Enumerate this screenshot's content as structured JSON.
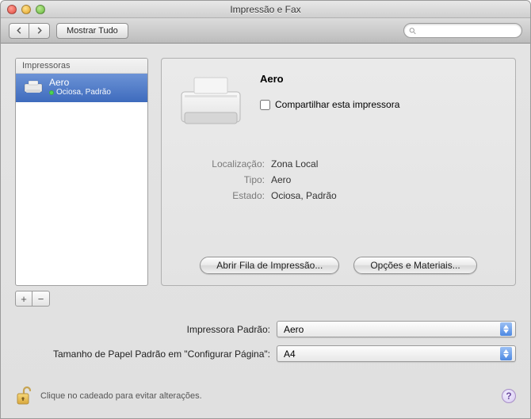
{
  "window": {
    "title": "Impressão e Fax"
  },
  "toolbar": {
    "show_all": "Mostrar Tudo",
    "search_placeholder": ""
  },
  "sidebar": {
    "header": "Impressoras",
    "printers": [
      {
        "name": "Aero",
        "status": "Ociosa, Padrão"
      }
    ],
    "add_label": "+",
    "remove_label": "−"
  },
  "panel": {
    "printer_name": "Aero",
    "share_label": "Compartilhar esta impressora",
    "meta": {
      "location_key": "Localização:",
      "location_val": "Zona Local",
      "type_key": "Tipo:",
      "type_val": "Aero",
      "state_key": "Estado:",
      "state_val": "Ociosa, Padrão"
    },
    "open_queue": "Abrir Fila de Impressão...",
    "options_supplies": "Opções e Materiais..."
  },
  "defaults": {
    "default_printer_label": "Impressora Padrão:",
    "default_printer_value": "Aero",
    "paper_size_label": "Tamanho de Papel Padrão em \"Configurar Página\":",
    "paper_size_value": "A4"
  },
  "footer": {
    "lock_text": "Clique no cadeado para evitar alterações.",
    "help": "?"
  }
}
